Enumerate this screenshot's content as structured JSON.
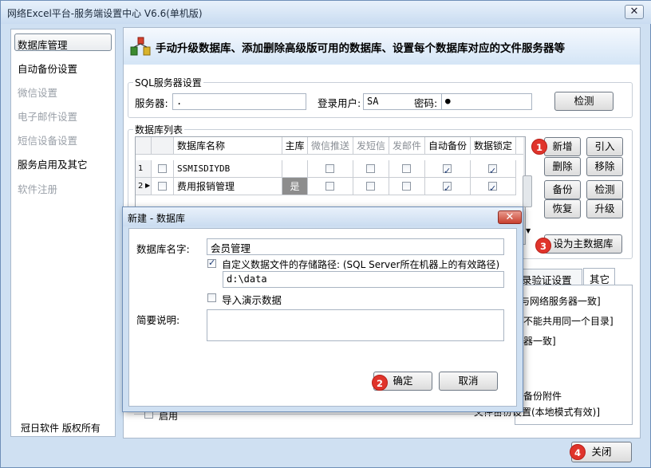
{
  "window": {
    "title": "网络Excel平台-服务端设置中心 V6.6(单机版)",
    "close": "✕"
  },
  "sidebar": {
    "items": [
      {
        "label": "数据库管理"
      },
      {
        "label": "自动备份设置"
      },
      {
        "label": "微信设置"
      },
      {
        "label": "电子邮件设置"
      },
      {
        "label": "短信设备设置"
      },
      {
        "label": "服务启用及其它"
      },
      {
        "label": "软件注册"
      }
    ],
    "footer": "冠日软件  版权所有"
  },
  "banner": {
    "text": "手动升级数据库、添加删除高级版可用的数据库、设置每个数据库对应的文件服务器等"
  },
  "sql": {
    "section": "SQL服务器设置",
    "server_label": "服务器:",
    "server_value": ".",
    "user_label": "登录用户:",
    "user_value": "SA",
    "pwd_label": "密码:",
    "pwd_value": "●",
    "check_btn": "检测"
  },
  "dblist": {
    "section": "数据库列表",
    "columns": [
      "数据库名称",
      "主库",
      "微信推送",
      "发短信",
      "发邮件",
      "自动备份",
      "数据锁定"
    ],
    "rows": [
      {
        "num": "1",
        "name": "SSMISDIYDB",
        "main": "",
        "wechat": false,
        "sms": false,
        "mail": false,
        "backup": true,
        "lock": true
      },
      {
        "num": "2",
        "name": "费用报销管理",
        "main": "是",
        "wechat": false,
        "sms": false,
        "mail": false,
        "backup": true,
        "lock": true
      }
    ],
    "buttons": {
      "new": "新增",
      "import": "引入",
      "delete": "删除",
      "move": "移除",
      "backup": "备份",
      "check": "检测",
      "restore": "恢复",
      "upgrade": "升级",
      "set_main": "设为主数据库"
    }
  },
  "tabs": {
    "login_verify": "录验证设置",
    "other": "其它"
  },
  "partial_texts": [
    "与网络服务器一致]",
    "不能共用同一个目录]",
    "器一致]",
    "备份附件",
    "文件备份设置(本地模式有效)]",
    "启用"
  ],
  "close_btn": "关闭",
  "badges": [
    "1",
    "2",
    "3",
    "4"
  ],
  "dialog": {
    "title": "新建 - 数据库",
    "name_label": "数据库名字:",
    "name_value": "会员管理",
    "custom_path_label": "自定义数据文件的存储路径: (SQL Server所在机器上的有效路径)",
    "custom_path_checked": true,
    "path_value": "d:\\data",
    "import_demo_label": "导入演示数据",
    "import_demo_checked": false,
    "desc_label": "简要说明:",
    "desc_value": "",
    "ok": "确定",
    "cancel": "取消"
  },
  "colors": {
    "accent_badge": "#e0342b",
    "window_bg": "#cfe0f2"
  }
}
